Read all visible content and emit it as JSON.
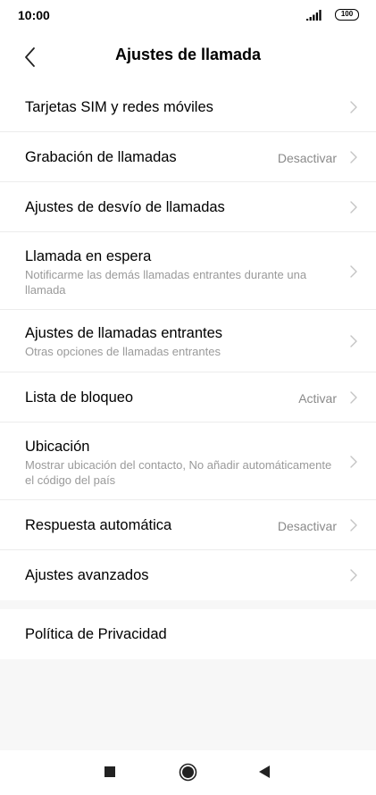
{
  "status_bar": {
    "time": "10:00",
    "battery": "100"
  },
  "header": {
    "title": "Ajustes de llamada"
  },
  "settings": [
    {
      "title": "Tarjetas SIM y redes móviles",
      "subtitle": "",
      "value": ""
    },
    {
      "title": "Grabación de llamadas",
      "subtitle": "",
      "value": "Desactivar"
    },
    {
      "title": "Ajustes de desvío de llamadas",
      "subtitle": "",
      "value": ""
    },
    {
      "title": "Llamada en espera",
      "subtitle": "Notificarme las demás llamadas entrantes durante una llamada",
      "value": ""
    },
    {
      "title": "Ajustes de llamadas entrantes",
      "subtitle": "Otras opciones de llamadas entrantes",
      "value": ""
    },
    {
      "title": "Lista de bloqueo",
      "subtitle": "",
      "value": "Activar"
    },
    {
      "title": "Ubicación",
      "subtitle": "Mostrar ubicación del contacto, No añadir automáticamente el código del país",
      "value": ""
    },
    {
      "title": "Respuesta automática",
      "subtitle": "",
      "value": "Desactivar"
    },
    {
      "title": "Ajustes avanzados",
      "subtitle": "",
      "value": ""
    }
  ],
  "privacy": {
    "title": "Política de Privacidad"
  },
  "nav": {
    "recents_icon": "square-icon",
    "home_icon": "circle-icon",
    "back_icon": "triangle-icon"
  },
  "colors": {
    "background": "#f7f7f7",
    "surface": "#ffffff",
    "secondary_text": "#9a9a9a",
    "chevron": "#c4c4c4"
  }
}
